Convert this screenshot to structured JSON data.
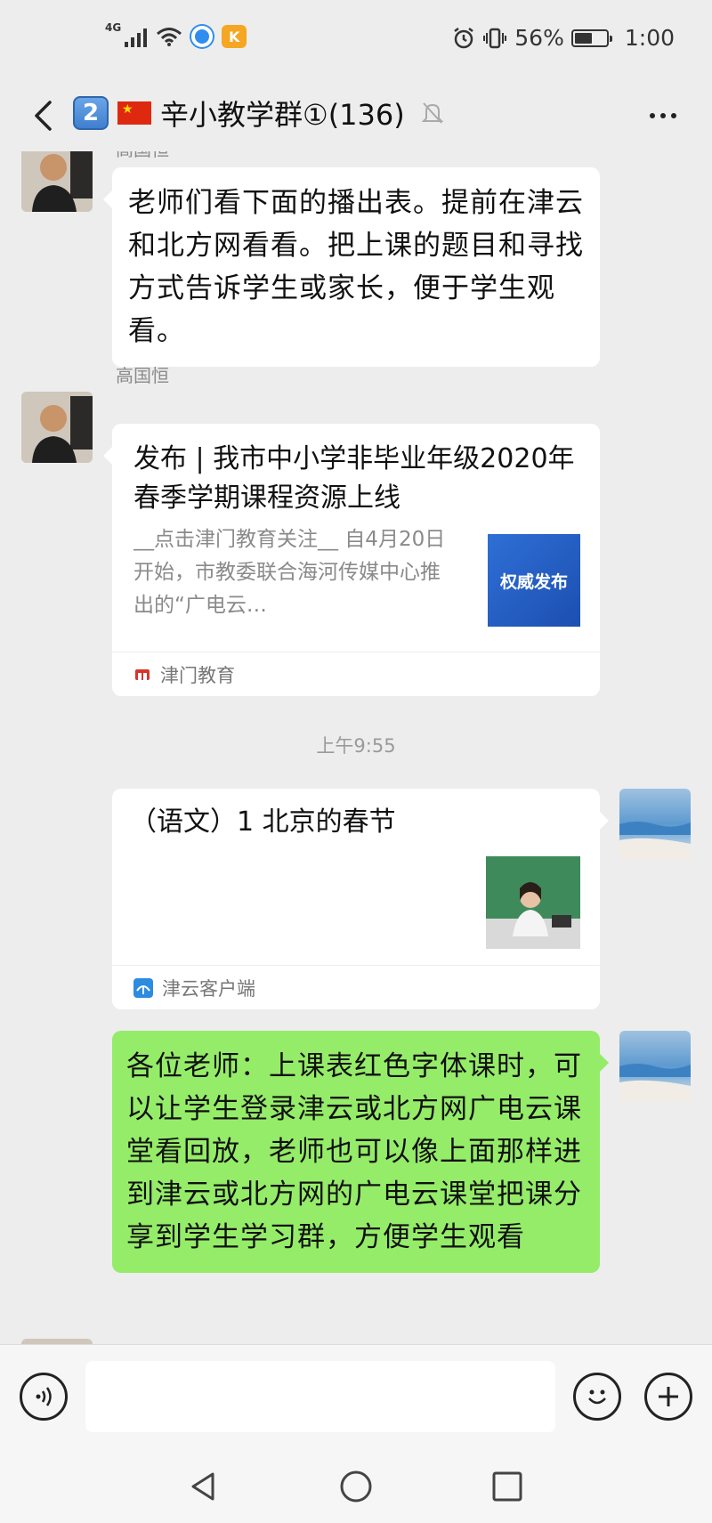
{
  "status_bar": {
    "network": "4G",
    "battery_text": "56%",
    "battery_level": 0.56,
    "time": "1:00",
    "app_badge_label": "K"
  },
  "header": {
    "back_icon": "chevron-left-icon",
    "badge_number": "2",
    "flag_icon": "china-flag-icon",
    "title": "辛小教学群①(136)",
    "mute_icon": "bell-muted-icon",
    "more_icon": "ellipsis-icon"
  },
  "messages": [
    {
      "type": "text",
      "side": "left",
      "sender": "高国恒",
      "text": "老师们看下面的播出表。提前在津云和北方网看看。把上课的题目和寻找方式告诉学生或家长，便于学生观看。"
    },
    {
      "type": "article_card",
      "side": "left",
      "sender": "高国恒",
      "title": "发布 | 我市中小学非毕业年级2020年春季学期课程资源上线",
      "description": "__点击津门教育关注__      自4月20日开始，市教委联合海河传媒中心推出的“广电云…",
      "thumbnail_text": "权威发布",
      "source": "津门教育"
    },
    {
      "type": "timestamp",
      "text": "上午9:55"
    },
    {
      "type": "video_card",
      "side": "right",
      "title": "（语文）1 北京的春节",
      "source": "津云客户端"
    },
    {
      "type": "text",
      "side": "right",
      "text": "各位老师：上课表红色字体课时，可以让学生登录津云或北方网广电云课堂看回放，老师也可以像上面那样进到津云或北方网的广电云课堂把课分享到学生学习群，方便学生观看"
    }
  ],
  "input_bar": {
    "voice_icon": "voice-icon",
    "input_value": "",
    "emoji_icon": "emoji-icon",
    "plus_icon": "plus-icon"
  },
  "nav_bar": {
    "back_icon": "triangle-back-icon",
    "home_icon": "circle-home-icon",
    "recents_icon": "square-recents-icon"
  },
  "colors": {
    "background": "#ededed",
    "bubble_green": "#95ec69",
    "bubble_white": "#ffffff"
  }
}
